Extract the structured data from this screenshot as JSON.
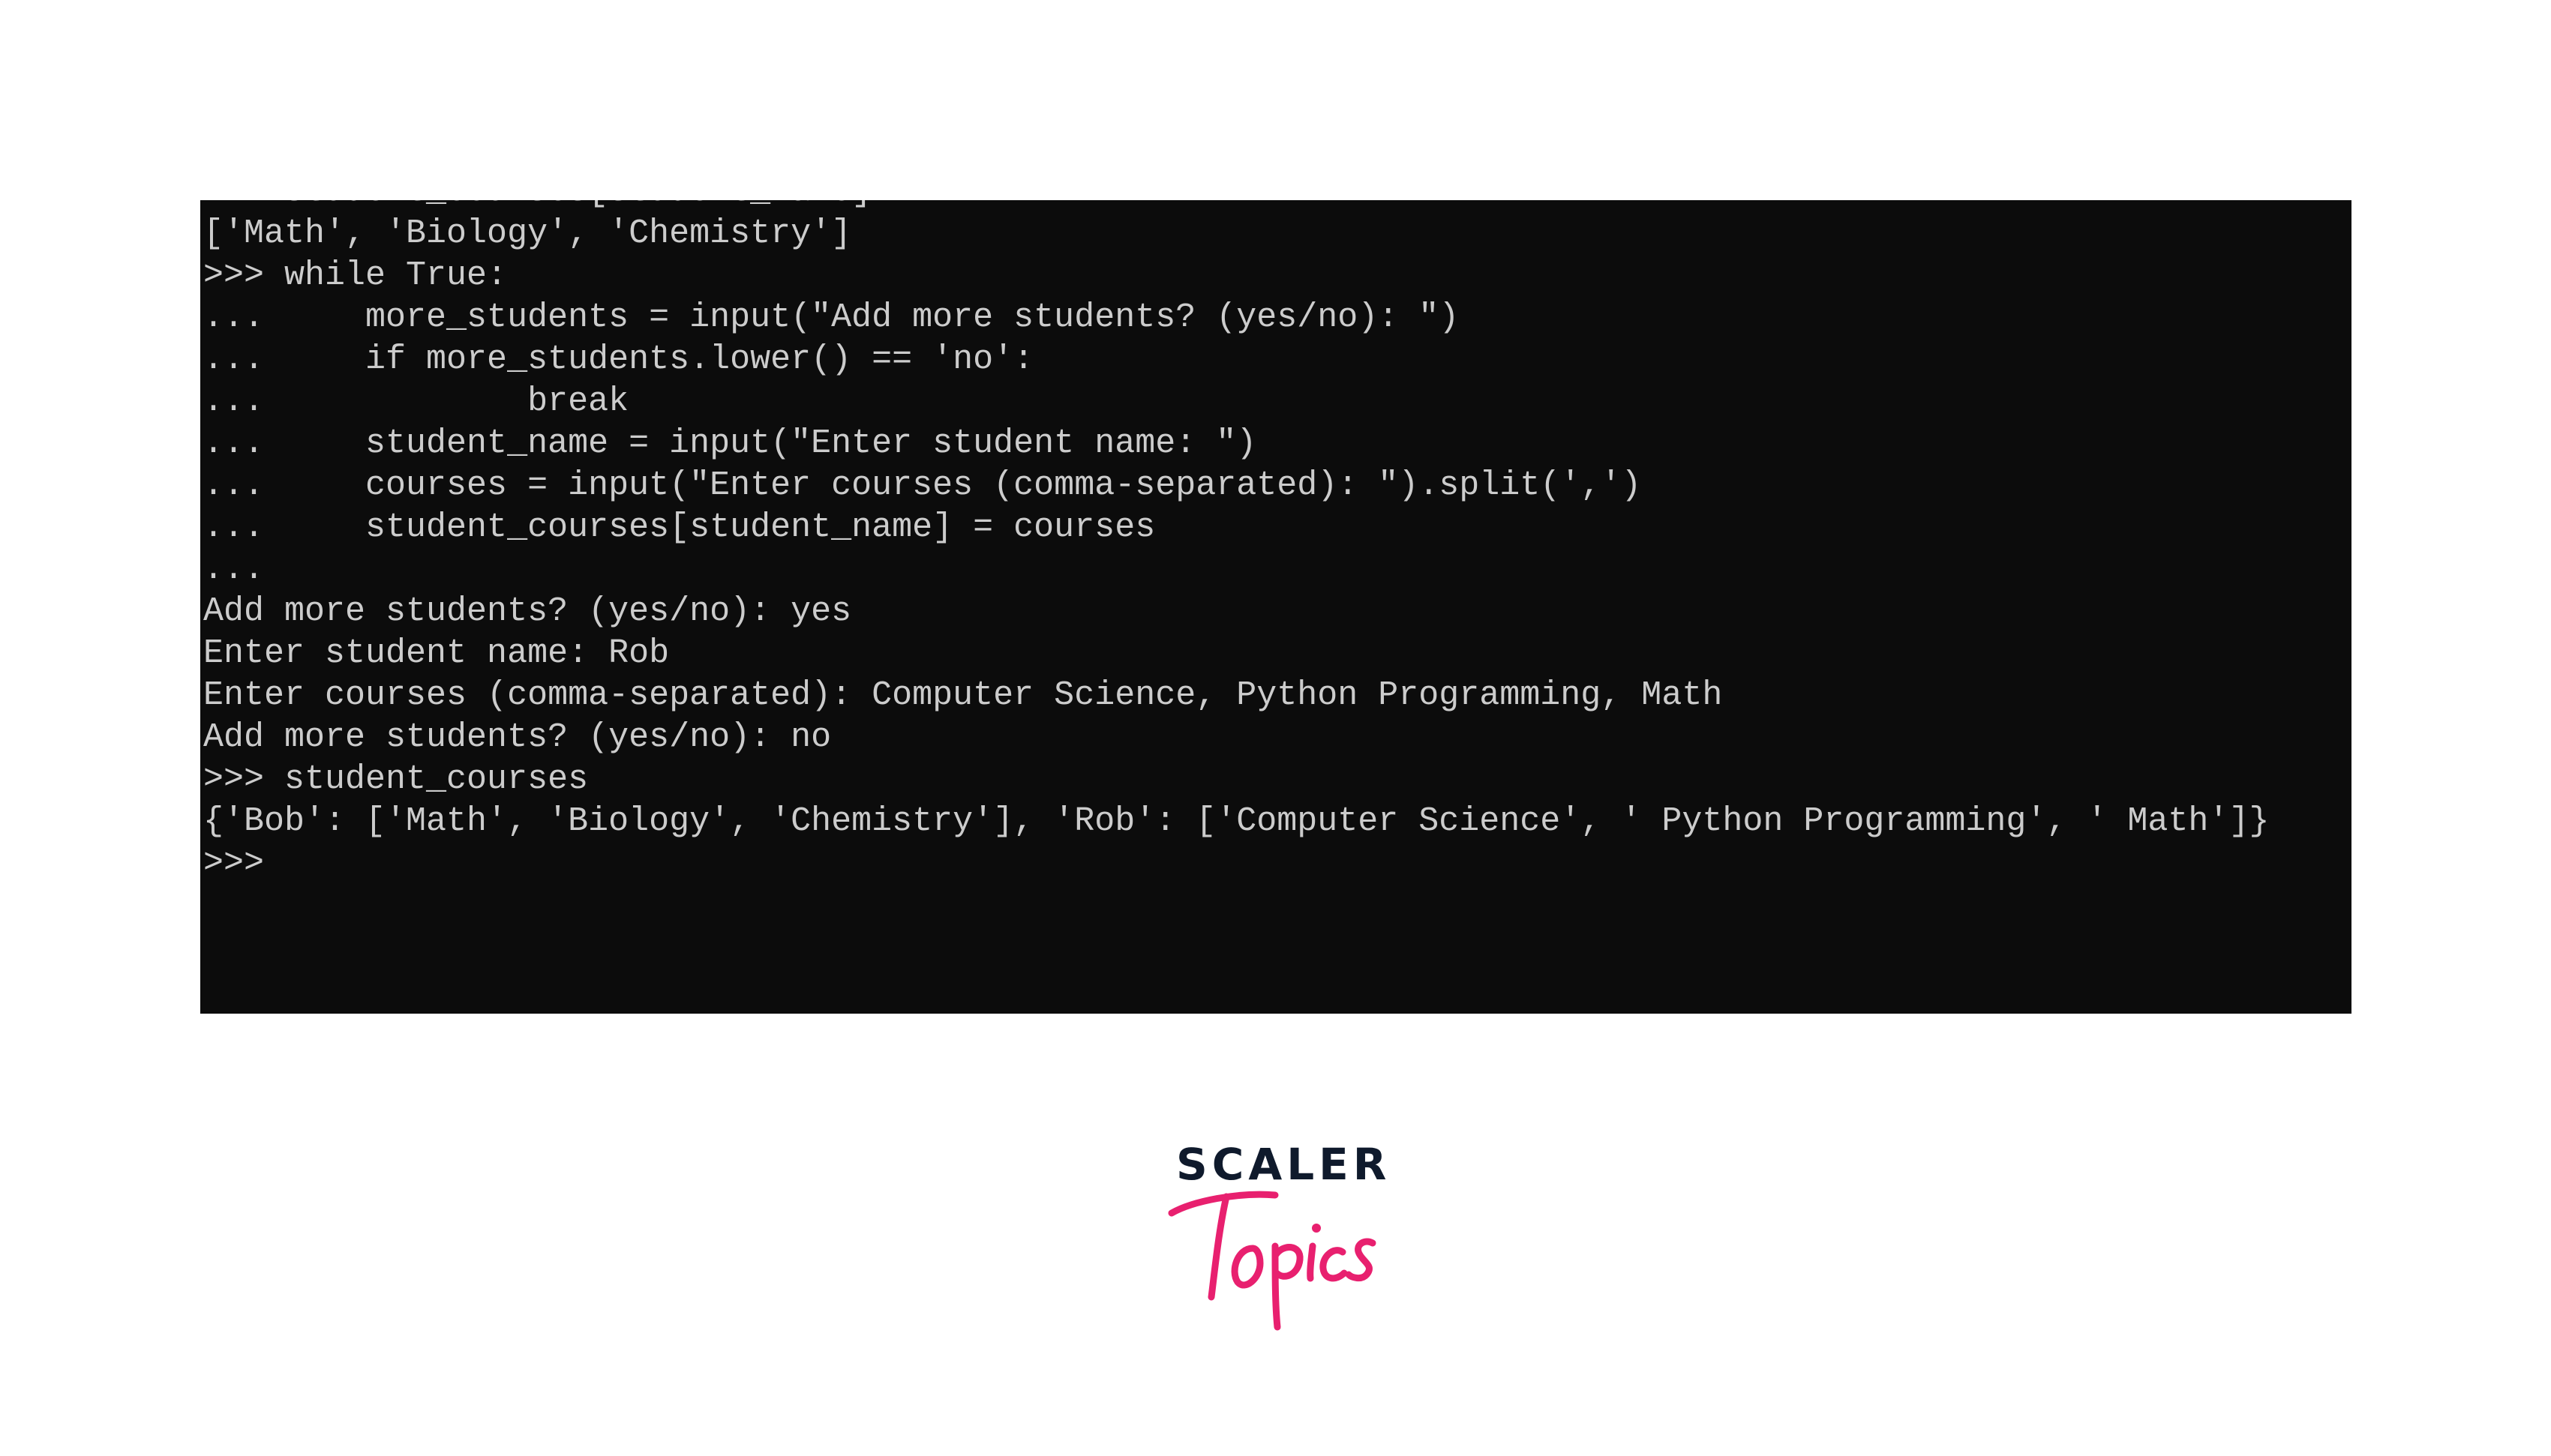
{
  "terminal": {
    "background": "#0c0c0c",
    "text_color": "#cccccc",
    "lines": [
      "    student_courses[student_name]",
      "['Math', 'Biology', 'Chemistry']",
      ">>> while True:",
      "...     more_students = input(\"Add more students? (yes/no): \")",
      "...     if more_students.lower() == 'no':",
      "...             break",
      "...     student_name = input(\"Enter student name: \")",
      "...     courses = input(\"Enter courses (comma-separated): \").split(',')",
      "...     student_courses[student_name] = courses",
      "...",
      "Add more students? (yes/no): yes",
      "Enter student name: Rob",
      "Enter courses (comma-separated): Computer Science, Python Programming, Math",
      "Add more students? (yes/no): no",
      ">>> student_courses",
      "{'Bob': ['Math', 'Biology', 'Chemistry'], 'Rob': ['Computer Science', ' Python Programming', ' Math']}",
      ">>>"
    ]
  },
  "logo": {
    "brand": "SCALER",
    "sub": "Topics",
    "brand_color": "#0f1a2c",
    "sub_color": "#e8206f"
  }
}
